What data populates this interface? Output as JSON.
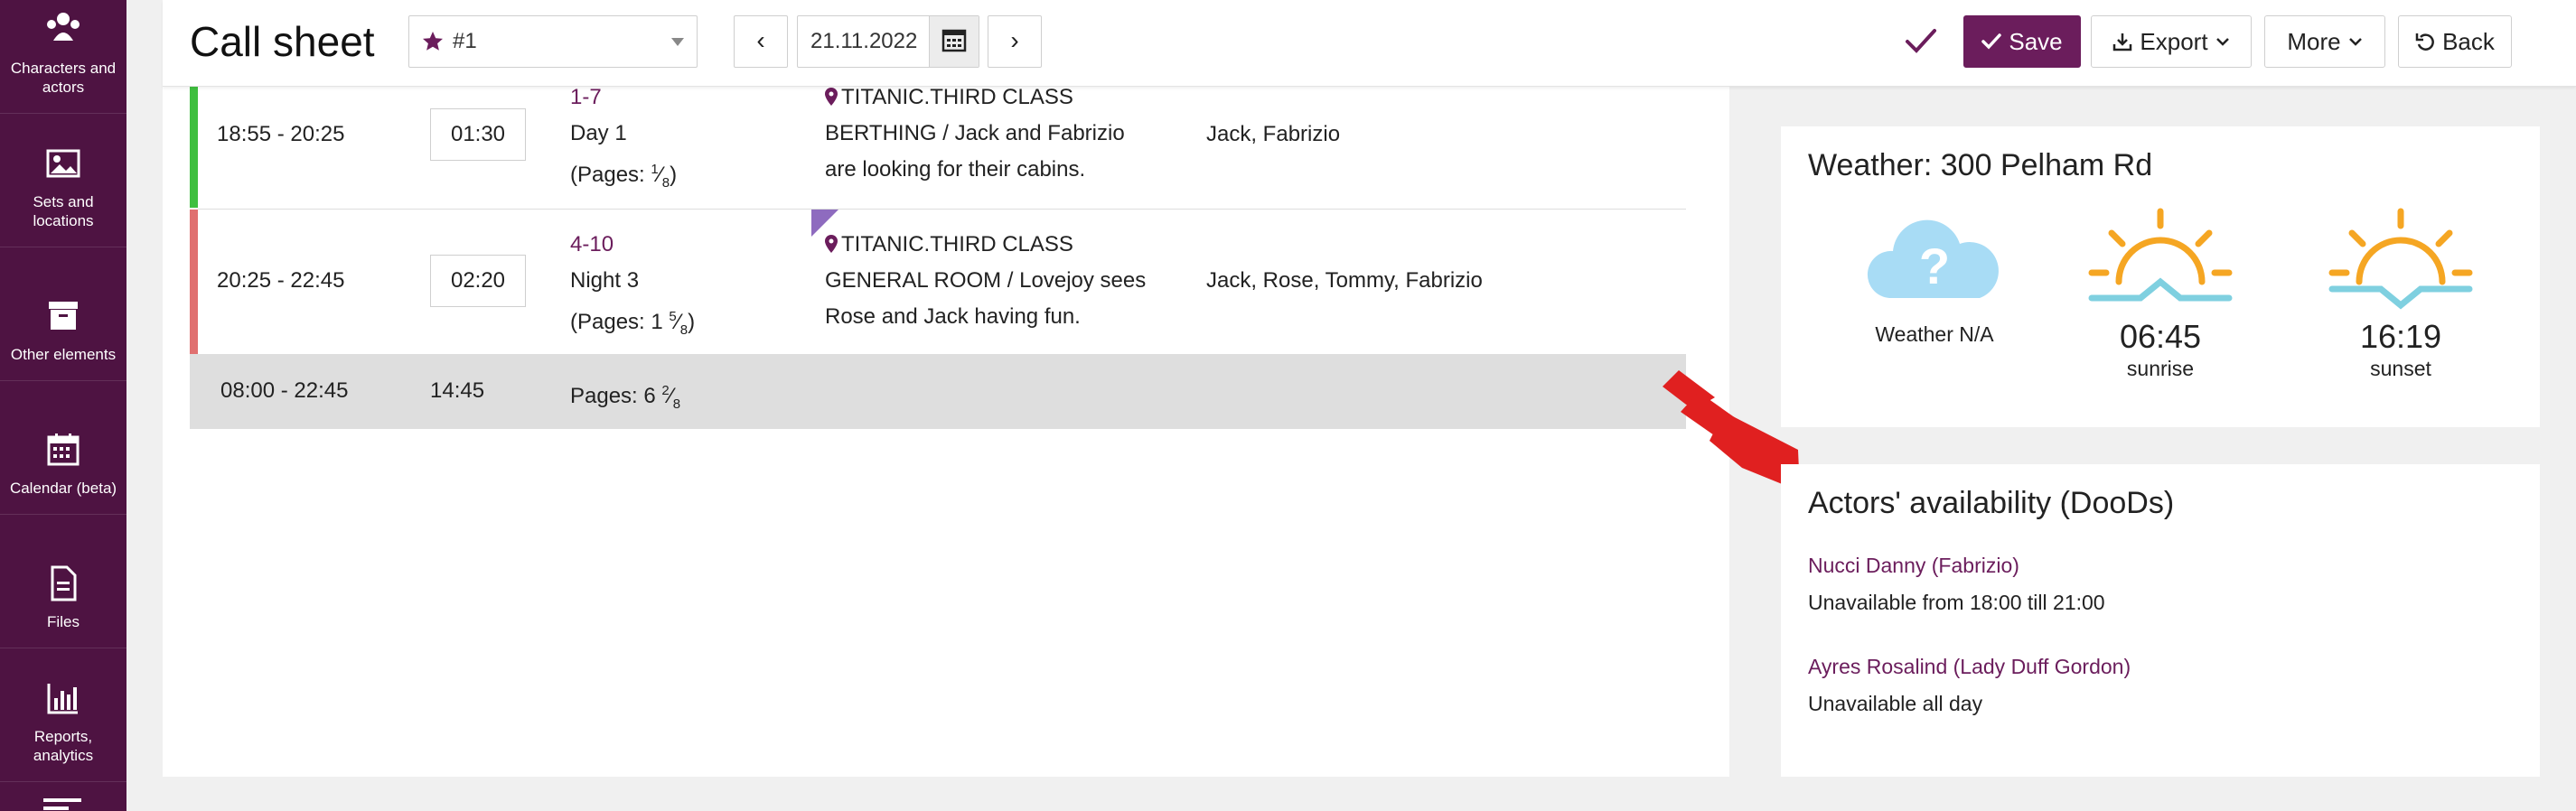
{
  "sidebar": {
    "items": [
      {
        "label_1": "Characters and",
        "label_2": "actors",
        "icon": "people-icon"
      },
      {
        "label_1": "Sets and",
        "label_2": "locations",
        "icon": "image-icon"
      },
      {
        "label_1": "Other elements",
        "label_2": "",
        "icon": "archive-icon"
      },
      {
        "label_1": "Calendar (beta)",
        "label_2": "",
        "icon": "calendar-icon"
      },
      {
        "label_1": "Files",
        "label_2": "",
        "icon": "file-icon"
      },
      {
        "label_1": "Reports,",
        "label_2": "analytics",
        "icon": "bar-chart-icon"
      }
    ]
  },
  "header": {
    "title": "Call sheet",
    "select_value": "#1",
    "prev": "‹",
    "next": "›",
    "date": "21.11.2022",
    "save": "Save",
    "export": "Export",
    "more": "More",
    "back": "Back"
  },
  "rows": [
    {
      "time": "18:55 - 20:25",
      "duration": "01:30",
      "scene": "1-7",
      "day": "Day 1",
      "pages_prefix": "(Pages: ",
      "pages_num": "1",
      "pages_den": "8",
      "pages_suffix": ")",
      "location": "TITANIC.THIRD CLASS",
      "desc_1": "BERTHING / Jack and Fabrizio",
      "desc_2": "are looking for their cabins.",
      "cast": "Jack, Fabrizio",
      "stripe_color": "#3fbf3f"
    },
    {
      "time": "20:25 - 22:45",
      "duration": "02:20",
      "scene": "4-10",
      "day": "Night 3",
      "pages_prefix": "(Pages: 1 ",
      "pages_num": "5",
      "pages_den": "8",
      "pages_suffix": ")",
      "location": "TITANIC.THIRD CLASS",
      "desc_1": "GENERAL ROOM / Lovejoy sees",
      "desc_2": "Rose and Jack having fun.",
      "cast": "Jack, Rose, Tommy, Fabrizio",
      "stripe_color": "#e07070"
    }
  ],
  "total": {
    "time": "08:00 - 22:45",
    "duration": "14:45",
    "pages_prefix": "Pages: 6 ",
    "pages_num": "2",
    "pages_den": "8"
  },
  "weather": {
    "title": "Weather: 300 Pelham Rd",
    "status": "Weather N/A",
    "sunrise_time": "06:45",
    "sunrise_label": "sunrise",
    "sunset_time": "16:19",
    "sunset_label": "sunset"
  },
  "availability": {
    "title": "Actors' availability (DooDs)",
    "actors": [
      {
        "name": "Nucci Danny (Fabrizio)",
        "note": "Unavailable from 18:00 till 21:00"
      },
      {
        "name": "Ayres Rosalind (Lady Duff Gordon)",
        "note": "Unavailable all day"
      }
    ]
  },
  "colors": {
    "brand": "#6b1d5c",
    "sidebar": "#4e1342",
    "sun": "#f5a623",
    "horizon": "#7fd0e0",
    "cloud": "#a8dcf5",
    "arrow": "#e02020"
  }
}
